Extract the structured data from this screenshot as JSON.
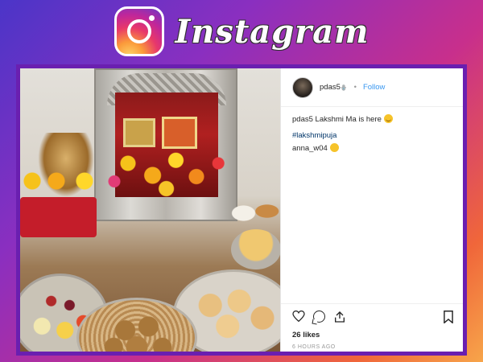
{
  "header": {
    "brand": "Instagram",
    "logo_icon": "instagram-camera-icon"
  },
  "post": {
    "image_alt": "Lakshmi puja altar with flowers, idols, fruits and sweets",
    "author": {
      "username": "pdas5",
      "badge": "🪬"
    },
    "separator": "•",
    "follow_label": "Follow",
    "caption": {
      "username": "pdas5",
      "text": "Lakshmi Ma is here"
    },
    "hashtag": "#lakshmipuja",
    "comment": "anna_w04",
    "actions": {
      "like_icon": "heart-icon",
      "comment_icon": "comment-icon",
      "share_icon": "share-icon",
      "save_icon": "bookmark-icon"
    },
    "likes": "26 likes",
    "time": "6 HOURS AGO"
  },
  "colors": {
    "card_border": "#6a1fb0",
    "follow": "#3897f0",
    "hashtag": "#003569",
    "text": "#262626",
    "muted": "#999999"
  }
}
